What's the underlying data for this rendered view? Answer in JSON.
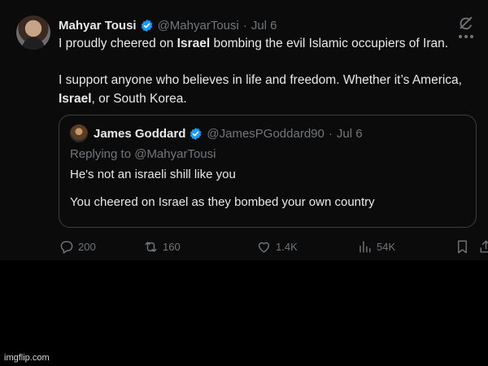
{
  "tweet": {
    "author_name": "Mahyar Tousi",
    "author_handle": "@MahyarTousi",
    "separator": "·",
    "date": "Jul 6",
    "body_1_a": "I proudly cheered on ",
    "body_1_b": "Israel",
    "body_1_c": " bombing the evil Islamic occupiers of Iran.",
    "body_2_a": "I support anyone who believes in life and freedom. Whether it’s America, ",
    "body_2_b": "Israel",
    "body_2_c": ", or South Korea."
  },
  "quote": {
    "author_name": "James Goddard",
    "author_handle": "@JamesPGoddard90",
    "separator": "·",
    "date": "Jul 6",
    "replying_to": "Replying to @MahyarTousi",
    "text_1": "He's not an israeli shill like you",
    "text_2": "You cheered on Israel as they bombed your own country"
  },
  "actions": {
    "replies": "200",
    "retweets": "160",
    "likes": "1.4K",
    "views": "54K"
  },
  "icons": {
    "verified": "verified-badge-icon",
    "grok": "grok-icon",
    "reply": "reply-icon",
    "retweet": "retweet-icon",
    "like": "heart-icon",
    "views": "views-chart-icon",
    "bookmark": "bookmark-icon",
    "share": "share-icon"
  },
  "colors": {
    "background": "#000000",
    "card": "#0b0b0b",
    "text": "#e7e9ea",
    "muted": "#71767b",
    "verified_blue": "#1d9bf0",
    "border": "#3a3f44"
  },
  "watermark": "imgflip.com"
}
